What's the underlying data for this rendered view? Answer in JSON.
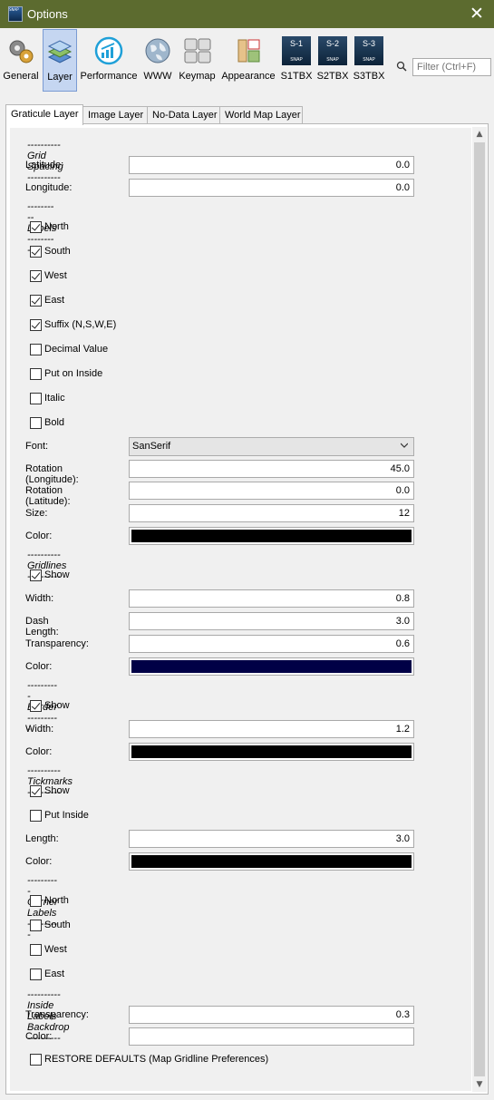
{
  "window": {
    "title": "Options"
  },
  "toolbar": {
    "items": [
      {
        "label": "General",
        "icon": "gears-icon"
      },
      {
        "label": "Layer",
        "icon": "layers-icon",
        "selected": true
      },
      {
        "label": "Performance",
        "icon": "speedometer-icon"
      },
      {
        "label": "WWW",
        "icon": "globe-icon"
      },
      {
        "label": "Keymap",
        "icon": "keyboard-icon"
      },
      {
        "label": "Appearance",
        "icon": "palette-icon"
      },
      {
        "label": "S1TBX",
        "icon": "sentinel-1-icon",
        "badge": "S-1"
      },
      {
        "label": "S2TBX",
        "icon": "sentinel-2-icon",
        "badge": "S-2"
      },
      {
        "label": "S3TBX",
        "icon": "sentinel-3-icon",
        "badge": "S-3"
      }
    ],
    "badge_sub": "SNAP",
    "filter_placeholder": "Filter (Ctrl+F)"
  },
  "tabs": [
    "Graticule Layer",
    "Image Layer",
    "No-Data Layer",
    "World Map Layer"
  ],
  "grid_spacing": {
    "header": "---------- Grid Spacing ----------",
    "latitude_label": "Latitude:",
    "latitude": "0.0",
    "longitude_label": "Longitude:",
    "longitude": "0.0"
  },
  "labels": {
    "header": "---------- Labels ----------",
    "north": "North",
    "south": "South",
    "west": "West",
    "east": "East",
    "suffix": "Suffix (N,S,W,E)",
    "decimal": "Decimal Value",
    "put_inside": "Put on Inside",
    "italic": "Italic",
    "bold": "Bold",
    "font_label": "Font:",
    "font": "SanSerif",
    "rot_lon_label": "Rotation (Longitude):",
    "rot_lon": "45.0",
    "rot_lat_label": "Rotation (Latitude):",
    "rot_lat": "0.0",
    "size_label": "Size:",
    "size": "12",
    "color_label": "Color:",
    "color": "#000000"
  },
  "gridlines": {
    "header": "---------- Gridlines ----------",
    "show": "Show",
    "width_label": "Width:",
    "width": "0.8",
    "dash_label": "Dash Length:",
    "dash": "3.0",
    "transparency_label": "Transparency:",
    "transparency": "0.6",
    "color_label": "Color:",
    "color": "#000046"
  },
  "border": {
    "header": "---------- Border ----------",
    "show": "Show",
    "width_label": "Width:",
    "width": "1.2",
    "color_label": "Color:",
    "color": "#000000"
  },
  "tickmarks": {
    "header": "---------- Tickmarks ----------",
    "show": "Show",
    "put_inside": "Put Inside",
    "length_label": "Length:",
    "length": "3.0",
    "color_label": "Color:",
    "color": "#000000"
  },
  "corner_labels": {
    "header": "---------- Corner Labels ----------",
    "north": "North",
    "south": "South",
    "west": "West",
    "east": "East"
  },
  "backdrop": {
    "header": "---------- Inside Labels Backdrop ----------",
    "transparency_label": "Transparency:",
    "transparency": "0.3",
    "color_label": "Color:",
    "color": "#ffffff"
  },
  "restore": "RESTORE DEFAULTS (Map Gridline Preferences)"
}
